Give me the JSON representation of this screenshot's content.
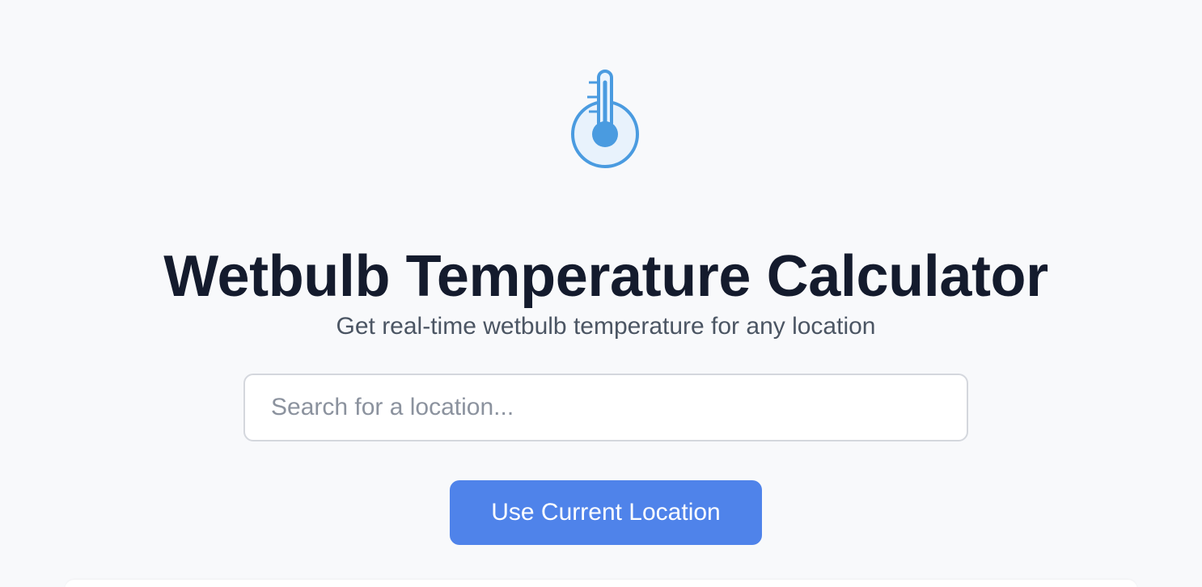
{
  "header": {
    "logo_icon": "thermometer-icon",
    "title": "Wetbulb Temperature Calculator",
    "subtitle": "Get real-time wetbulb temperature for any location"
  },
  "search": {
    "placeholder": "Search for a location...",
    "value": ""
  },
  "actions": {
    "current_location_label": "Use Current Location"
  },
  "colors": {
    "background": "#f8f9fb",
    "accent": "#4f83ea",
    "icon": "#4a9be0",
    "title": "#141b2d",
    "subtitle": "#4b5563"
  }
}
